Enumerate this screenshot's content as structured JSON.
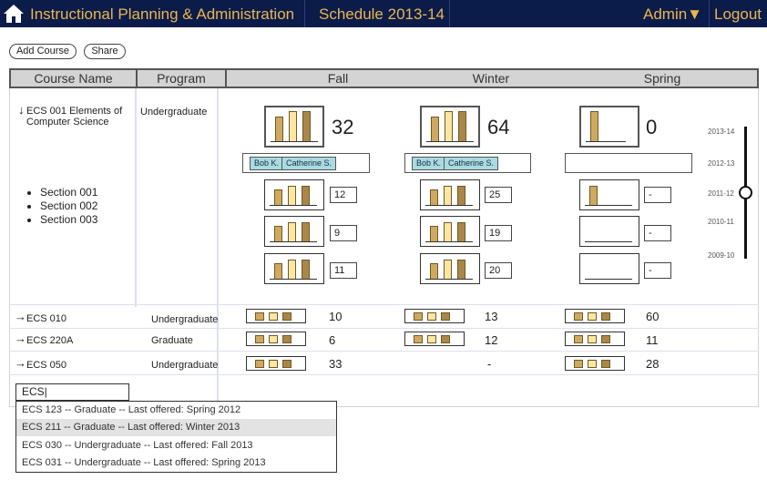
{
  "topbar": {
    "app_title": "Instructional Planning & Administration",
    "schedule_title": "Schedule 2013-14",
    "admin_label": "Admin▼",
    "logout_label": "Logout"
  },
  "toolbar": {
    "add_course_label": "Add Course",
    "share_label": "Share"
  },
  "table": {
    "headers": [
      "Course Name",
      "Program",
      "Fall",
      "Winter",
      "Spring"
    ],
    "expanded_course": {
      "name": "ECS 001 Elements of Computer Science",
      "program": "Undergraduate",
      "sections": [
        "Section 001",
        "Section 002",
        "Section 003"
      ],
      "fall": {
        "total": "32",
        "instructors": [
          "Bob K.",
          "Catherine S."
        ],
        "section_counts": [
          "12",
          "9",
          "11"
        ]
      },
      "winter": {
        "total": "64",
        "instructors": [
          "Bob K.",
          "Catherine S."
        ],
        "section_counts": [
          "25",
          "19",
          "20"
        ]
      },
      "spring": {
        "total": "0",
        "instructors": [],
        "section_counts": [
          "-",
          "-",
          "-"
        ]
      }
    },
    "courses": [
      {
        "name": "ECS 010",
        "program": "Undergraduate",
        "fall": "10",
        "winter": "13",
        "spring": "60"
      },
      {
        "name": "ECS 220A",
        "program": "Graduate",
        "fall": "6",
        "winter": "12",
        "spring": "11"
      },
      {
        "name": "ECS 050",
        "program": "Undergraduate",
        "fall": "33",
        "winter": "-",
        "spring": "28"
      }
    ]
  },
  "timeline": {
    "years": [
      "2013-14",
      "2012-13",
      "2011-12",
      "2010-11",
      "2009-10"
    ],
    "selected": "2011-12"
  },
  "autocomplete": {
    "value": "ECS|",
    "options": [
      "ECS 123 -- Graduate -- Last offered: Spring 2012",
      "ECS 211 -- Graduate -- Last offered: Winter 2013",
      "ECS 030 -- Undergraduate -- Last offered: Fall 2013",
      "ECS 031 -- Undergraduate -- Last offered: Spring 2013"
    ],
    "highlighted": "ECS 211 -- Graduate -- Last offered: Winter 2013"
  },
  "colors": {
    "topbar_bg": "#0b1b4a",
    "topbar_text": "#e9b64f",
    "chip_bg": "#a9dbe0",
    "bar_colors": [
      "#cfa961",
      "#ffe7a3",
      "#a98749"
    ]
  },
  "icons": {
    "home": "home-icon",
    "expand": "arrow-down-icon",
    "collapse": "arrow-right-icon"
  }
}
